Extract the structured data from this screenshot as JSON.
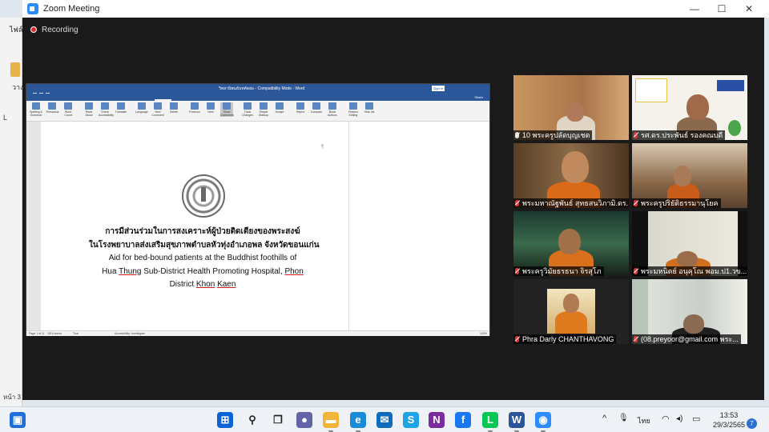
{
  "window": {
    "title": "Zoom Meeting",
    "minimize": "—",
    "maximize": "☐",
    "close": "✕"
  },
  "recording": {
    "label": "Recording"
  },
  "background_app": {
    "text1": "ไฟล์",
    "text2": "วาง",
    "text3": "L",
    "page_label": "หน้า 3"
  },
  "word": {
    "title": "วิทยานิพนธ์บทคัดย่อ - Compatibility Mode - Word",
    "sign_in": "Sign in",
    "tabs": [
      "File",
      "Home",
      "Insert",
      "Draw",
      "Design",
      "Layout",
      "References",
      "Mailings",
      "Review",
      "View",
      "Help",
      "ACROBAT"
    ],
    "active_tab": "Review",
    "tell_me": "Tell me what you want to do",
    "share": "Share",
    "ribbon": [
      {
        "label": "Spelling & Grammar"
      },
      {
        "label": "Thesaurus"
      },
      {
        "label": "Word Count"
      },
      {
        "label": "Read Aloud"
      },
      {
        "label": "Check Accessibility"
      },
      {
        "label": "Translate"
      },
      {
        "label": "Language"
      },
      {
        "label": "New Comment"
      },
      {
        "label": "Delete"
      },
      {
        "label": "Previous"
      },
      {
        "label": "Next"
      },
      {
        "label": "Show Comments"
      },
      {
        "label": "Track Changes"
      },
      {
        "label": "Simple Markup"
      },
      {
        "label": "Accept"
      },
      {
        "label": "Reject"
      },
      {
        "label": "Compare"
      },
      {
        "label": "Block Authors"
      },
      {
        "label": "Restrict Editing"
      },
      {
        "label": "Hide Ink"
      }
    ],
    "status": {
      "page": "Page 1 of 11",
      "words": "1514 words",
      "lang": "Thai",
      "focus": "Accessibility: Investigate",
      "zoom": "100%"
    },
    "doc": {
      "line1": "การมีส่วนร่วมในการสงเคราะห์ผู้ป่วยติดเตียงของพระสงฆ์",
      "line2": "ในโรงพยาบาลส่งเสริมสุขภาพตำบลหัวทุ่งอำเภอพล จังหวัดขอนแก่น",
      "line3": "Aid for bed-bound patients at the Buddhist foothills of",
      "line4a": "Hua ",
      "line4b": "Thung",
      "line4c": " Sub-District Health Promoting Hospital, ",
      "line4d": "Phon",
      "line5a": "District ",
      "line5b": "Khon",
      "line5c": " ",
      "line5d": "Kaen",
      "mark": "¶"
    }
  },
  "participants": [
    {
      "name": "10 พระครูปลัดบุญเชต",
      "muted": false
    },
    {
      "name": "รศ.ดร.ประพันธ์ รองคณบดี",
      "muted": true,
      "speaking": true
    },
    {
      "name": "พระมหาณัฐพันธ์ สุทธสนวิภามิ.ดร. ว...",
      "muted": true
    },
    {
      "name": "พระครูปริยัติธรรมานุโยค",
      "muted": true
    },
    {
      "name": "พระครูวิมัยธรธนา จิรสุโภ",
      "muted": true
    },
    {
      "name": "พระมหนิตย์ อนุคุโณ พอม.ป1.วข...",
      "muted": true
    },
    {
      "name": "Phra Darly CHANTHAVONG",
      "muted": true
    },
    {
      "name": "(08.preyoor@gmail.com พระ...",
      "muted": true
    }
  ],
  "taskbar": {
    "apps": [
      {
        "name": "widgets",
        "color": "#1e6fd9",
        "glyph": "▣"
      },
      {
        "name": "start",
        "color": "#0a64d6",
        "glyph": "⊞"
      },
      {
        "name": "search",
        "color": "#2b2b2b",
        "glyph": "⚲"
      },
      {
        "name": "task-view",
        "color": "#2b2b2b",
        "glyph": "❐"
      },
      {
        "name": "teams-chat",
        "color": "#6264a7",
        "glyph": "●"
      },
      {
        "name": "file-explorer",
        "color": "#f2b53a",
        "glyph": "▬"
      },
      {
        "name": "edge",
        "color": "#1a8bd6",
        "glyph": "e"
      },
      {
        "name": "mail",
        "color": "#0f6cbd",
        "glyph": "✉"
      },
      {
        "name": "skype",
        "color": "#1da3e6",
        "glyph": "S"
      },
      {
        "name": "onenote",
        "color": "#7a2b9e",
        "glyph": "N"
      },
      {
        "name": "facebook",
        "color": "#1877f2",
        "glyph": "f"
      },
      {
        "name": "line",
        "color": "#06c755",
        "glyph": "L"
      },
      {
        "name": "word",
        "color": "#2b579a",
        "glyph": "W"
      },
      {
        "name": "zoom",
        "color": "#2d8cff",
        "glyph": "◉"
      }
    ],
    "tray": {
      "chevron": "^",
      "mic": "🎙",
      "lang": "ไทย",
      "wifi": "◠",
      "volume": "◂)",
      "battery": "▭"
    },
    "clock": {
      "time": "13:53",
      "date": "29/3/2565"
    },
    "notifications": "7"
  }
}
